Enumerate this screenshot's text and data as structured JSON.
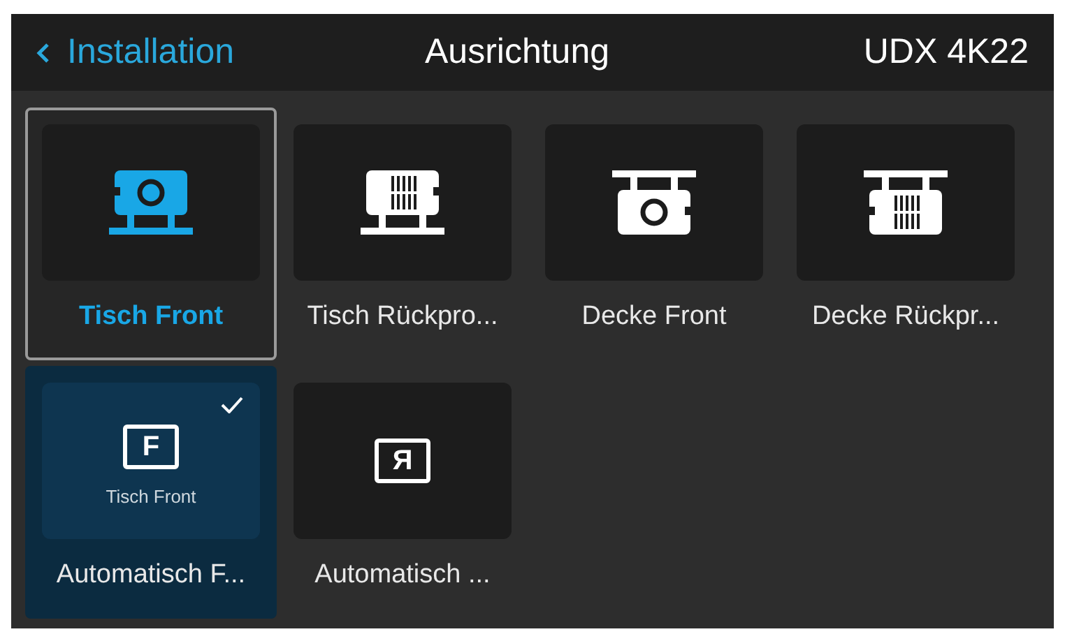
{
  "header": {
    "back": "Installation",
    "title": "Ausrichtung",
    "device": "UDX 4K22"
  },
  "items": [
    {
      "kind": "table-front",
      "label": "Tisch Front",
      "selected": true,
      "checked": false
    },
    {
      "kind": "table-rear",
      "label": "Tisch Rückpro...",
      "selected": false,
      "checked": false
    },
    {
      "kind": "ceiling-front",
      "label": "Decke Front",
      "selected": false,
      "checked": false
    },
    {
      "kind": "ceiling-rear",
      "label": "Decke Rückpr...",
      "selected": false,
      "checked": false
    },
    {
      "kind": "auto",
      "glyph": "F",
      "sublabel": "Tisch Front",
      "label": "Automatisch F...",
      "selected": false,
      "checked": true
    },
    {
      "kind": "auto",
      "glyph": "Я",
      "label": "Automatisch ...",
      "selected": false,
      "checked": false
    }
  ]
}
